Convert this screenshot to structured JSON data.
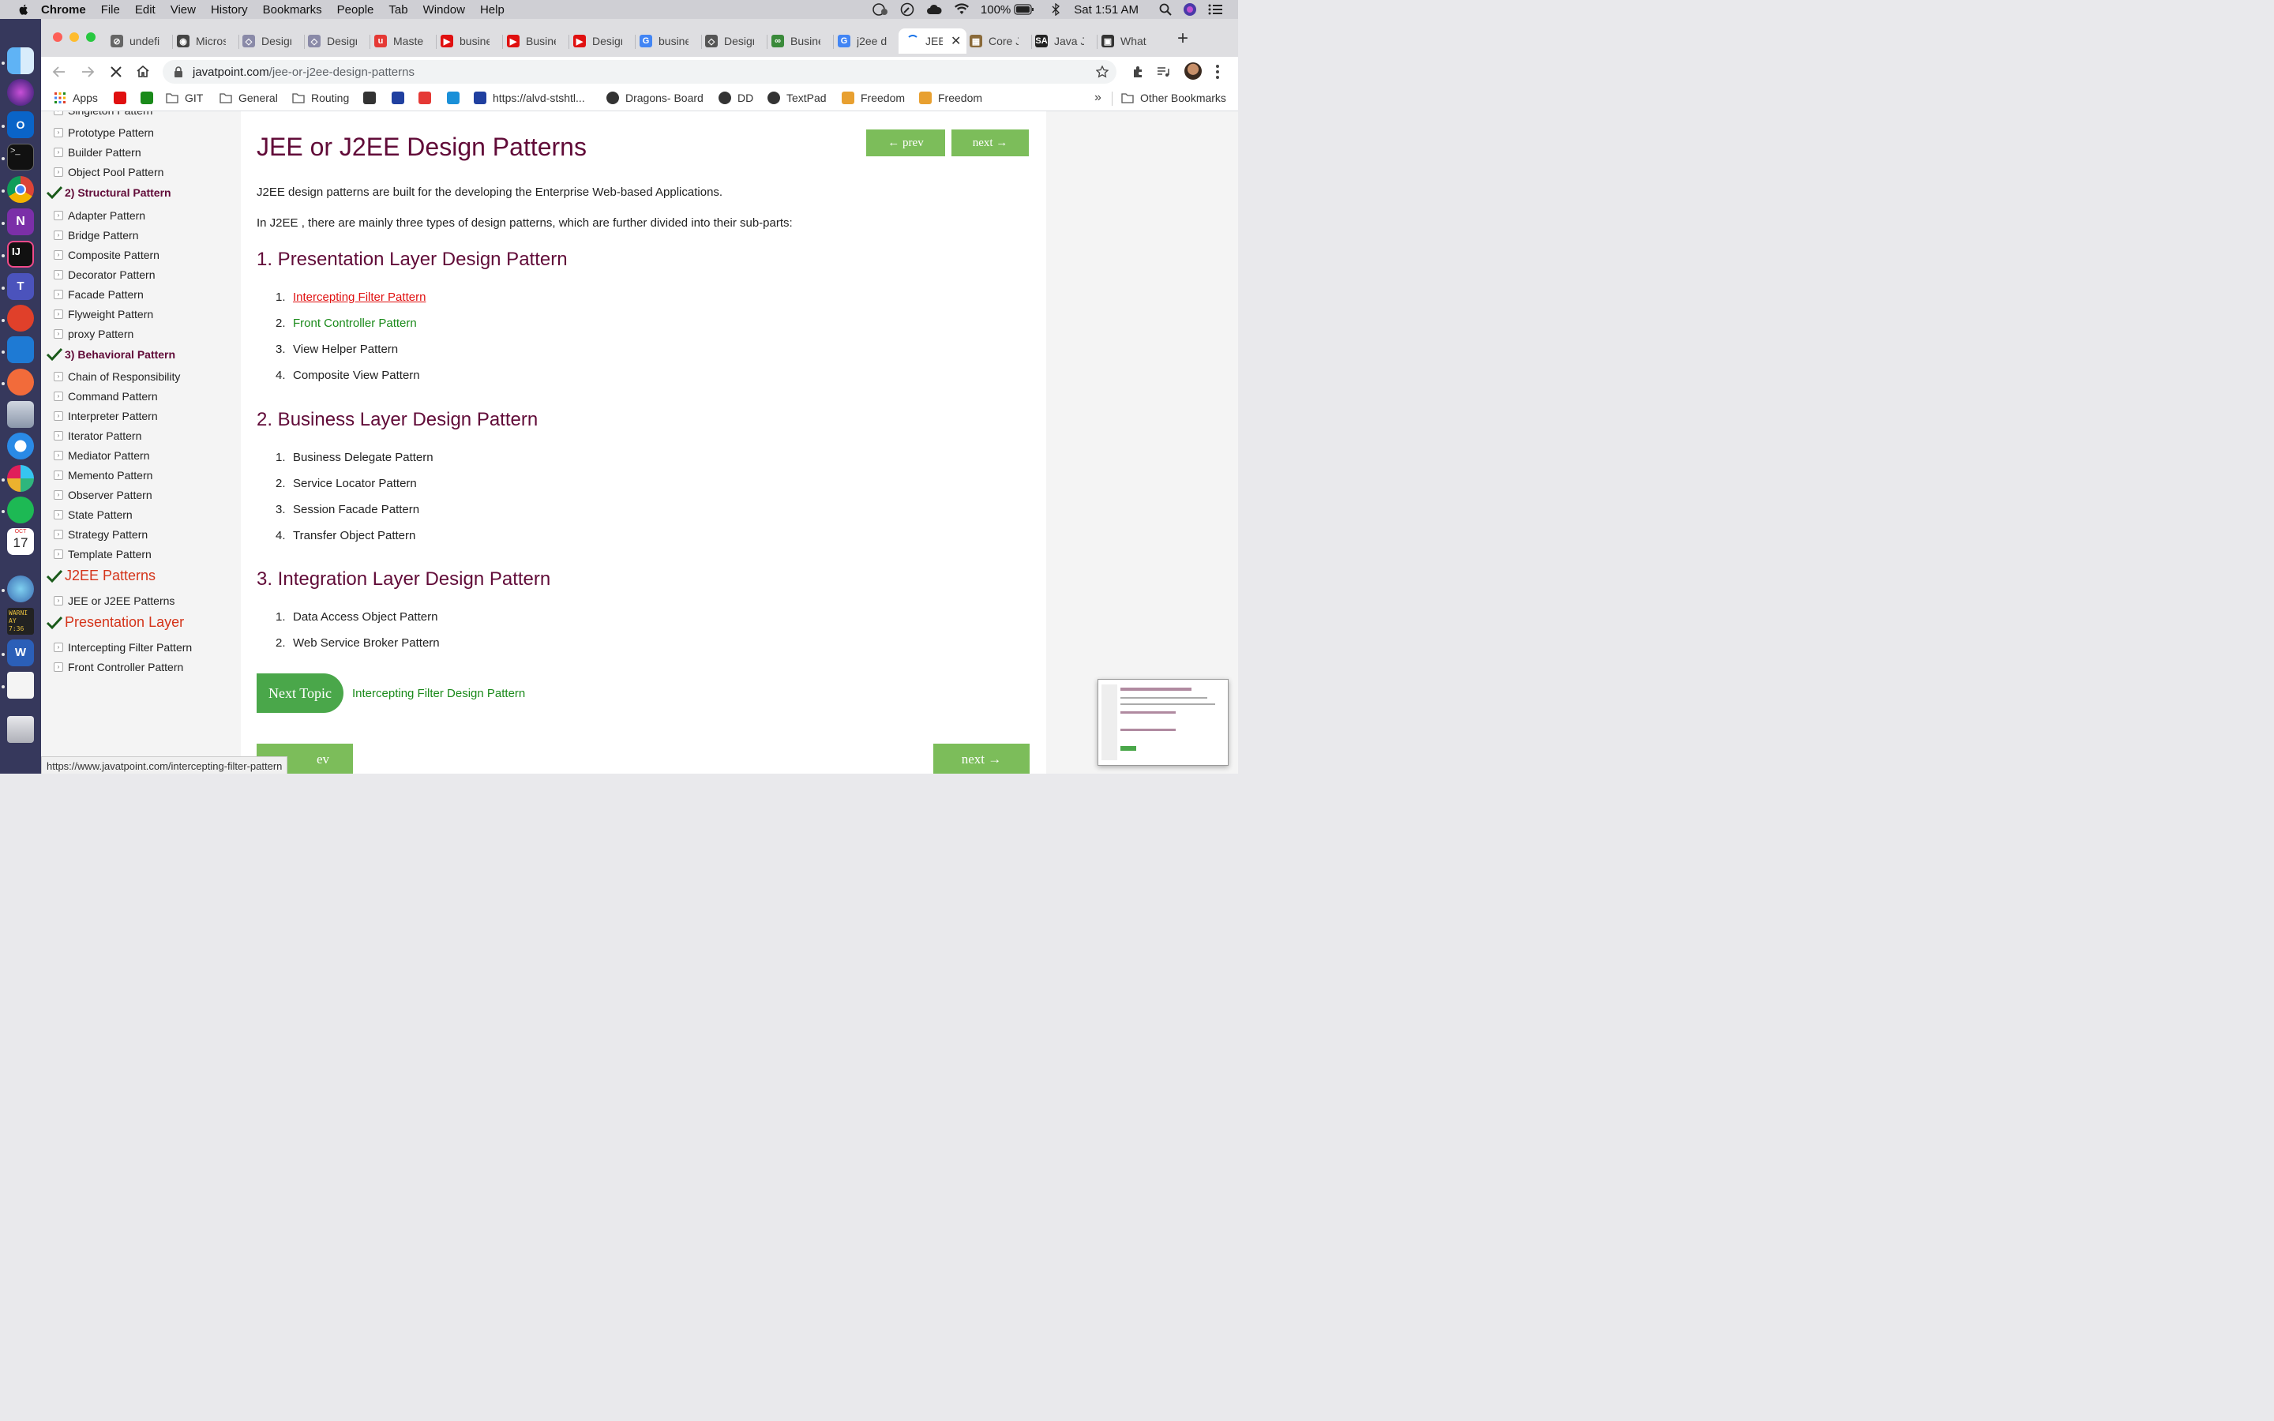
{
  "menubar": {
    "app": "Chrome",
    "items": [
      "File",
      "Edit",
      "View",
      "History",
      "Bookmarks",
      "People",
      "Tab",
      "Window",
      "Help"
    ],
    "battery": "100%",
    "clock": "Sat 1:51 AM"
  },
  "dock": {
    "calendar_month": "OCT",
    "calendar_day": "17",
    "console_line1": "WARNI",
    "console_line2": "AY 7:36"
  },
  "tabs": [
    {
      "title": "undefi",
      "color": "#666"
    },
    {
      "title": "Micros",
      "color": "#444"
    },
    {
      "title": "Desigr",
      "color": "#8a8aa8"
    },
    {
      "title": "Desigr",
      "color": "#8a8aa8"
    },
    {
      "title": "Maste",
      "color": "#e53935"
    },
    {
      "title": "busine",
      "color": "#e01010"
    },
    {
      "title": "Busine",
      "color": "#e01010"
    },
    {
      "title": "Desigr",
      "color": "#e01010"
    },
    {
      "title": "busine",
      "color": "#4285f4"
    },
    {
      "title": "Desigr",
      "color": "#555"
    },
    {
      "title": "Busine",
      "color": "#3a8a3a"
    },
    {
      "title": "j2ee d",
      "color": "#4285f4"
    },
    {
      "title": "JEE",
      "color": "#1a73e8"
    },
    {
      "title": "Core J",
      "color": "#8a6a3a"
    },
    {
      "title": "Java J",
      "color": "#222"
    },
    {
      "title": "What",
      "color": "#333"
    }
  ],
  "address": {
    "domain": "javatpoint.com",
    "path": "/jee-or-j2ee-design-patterns"
  },
  "bookmarks": [
    {
      "label": "Apps",
      "icon": "apps-grid-icon"
    },
    {
      "label": "",
      "icon": "youtube-icon"
    },
    {
      "label": "",
      "icon": "refresh-green-icon"
    },
    {
      "label": "GIT",
      "icon": "folder-icon"
    },
    {
      "label": "General",
      "icon": "folder-icon"
    },
    {
      "label": "Routing",
      "icon": "folder-icon"
    },
    {
      "label": "",
      "icon": "braces-icon"
    },
    {
      "label": "",
      "icon": "chart-icon"
    },
    {
      "label": "",
      "icon": "udemy-icon"
    },
    {
      "label": "",
      "icon": "cloud-icon"
    },
    {
      "label": "https://alvd-stshtl...",
      "icon": "chart-icon"
    },
    {
      "label": "Dragons- Board",
      "icon": "globe-icon"
    },
    {
      "label": "DD",
      "icon": "globe-icon"
    },
    {
      "label": "TextPad",
      "icon": "globe-icon"
    },
    {
      "label": "Freedom",
      "icon": "freedom-icon"
    },
    {
      "label": "Freedom",
      "icon": "freedom-icon"
    }
  ],
  "bookmarks_more": "»",
  "other_bookmarks": "Other Bookmarks",
  "sidebar": {
    "items_top": [
      "Singleton Pattern",
      "Prototype Pattern",
      "Builder Pattern",
      "Object Pool Pattern"
    ],
    "structural_heading": "2) Structural Pattern",
    "structural_items": [
      "Adapter Pattern",
      "Bridge Pattern",
      "Composite Pattern",
      "Decorator Pattern",
      "Facade Pattern",
      "Flyweight Pattern",
      "proxy Pattern"
    ],
    "behavioral_heading": "3) Behavioral Pattern",
    "behavioral_items": [
      "Chain of Responsibility",
      "Command Pattern",
      "Interpreter Pattern",
      "Iterator Pattern",
      "Mediator Pattern",
      "Memento Pattern",
      "Observer Pattern",
      "State Pattern",
      "Strategy Pattern",
      "Template Pattern"
    ],
    "j2ee_heading": "J2EE Patterns",
    "j2ee_items": [
      "JEE or J2EE Patterns"
    ],
    "presentation_heading": "Presentation Layer",
    "presentation_items": [
      "Intercepting Filter Pattern",
      "Front Controller Pattern"
    ]
  },
  "main": {
    "title": "JEE or J2EE Design Patterns",
    "prev": "← prev",
    "next": "next →",
    "intro1": "J2EE design patterns are built for the developing the Enterprise Web-based Applications.",
    "intro2": "In J2EE , there are mainly three types of design patterns, which are further divided into their sub-parts:",
    "sections": [
      {
        "heading": "1. Presentation Layer Design Pattern",
        "items": [
          "Intercepting Filter Pattern",
          "Front Controller Pattern",
          "View Helper Pattern",
          "Composite View Pattern"
        ]
      },
      {
        "heading": "2. Business Layer Design Pattern",
        "items": [
          "Business Delegate Pattern",
          "Service Locator Pattern",
          "Session Facade Pattern",
          "Transfer Object Pattern"
        ]
      },
      {
        "heading": "3. Integration Layer Design Pattern",
        "items": [
          "Data Access Object Pattern",
          "Web Service Broker Pattern"
        ]
      }
    ],
    "next_topic_label": "Next Topic",
    "next_topic_link": "Intercepting Filter Design Pattern",
    "bottom_prev": "ev",
    "bottom_next": "next →"
  },
  "status_url": "https://www.javatpoint.com/intercepting-filter-pattern",
  "colors": {
    "heading": "#610b38",
    "accent_red": "#d4341a",
    "link_green": "#1a8a1a",
    "link_hover_red": "#e01010",
    "button_green": "#7cbd5a"
  }
}
